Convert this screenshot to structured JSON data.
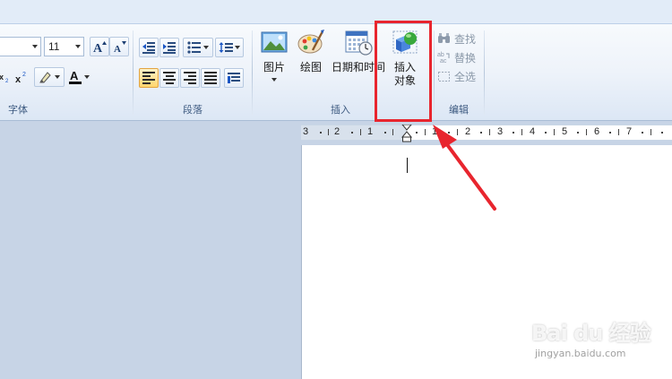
{
  "font_group": {
    "size_value": "11",
    "label": "字体"
  },
  "paragraph_group": {
    "label": "段落"
  },
  "insert_group": {
    "label": "插入",
    "picture_label": "图片",
    "paint_label": "绘图",
    "datetime_label": "日期和时间",
    "object_label_line1": "插入",
    "object_label_line2": "对象"
  },
  "edit_group": {
    "label": "编辑",
    "find_label": "查找",
    "replace_label": "替换",
    "selectall_label": "全选"
  },
  "ruler": {
    "numbers": [
      "3",
      "2",
      "1",
      "1",
      "2",
      "3",
      "4",
      "5",
      "6",
      "7"
    ]
  },
  "watermark": {
    "brand": "Bai du 经验",
    "url": "jingyan.baidu.com"
  },
  "colors": {
    "highlight": "#e8252e",
    "font_color_swatch": "#d01010"
  }
}
